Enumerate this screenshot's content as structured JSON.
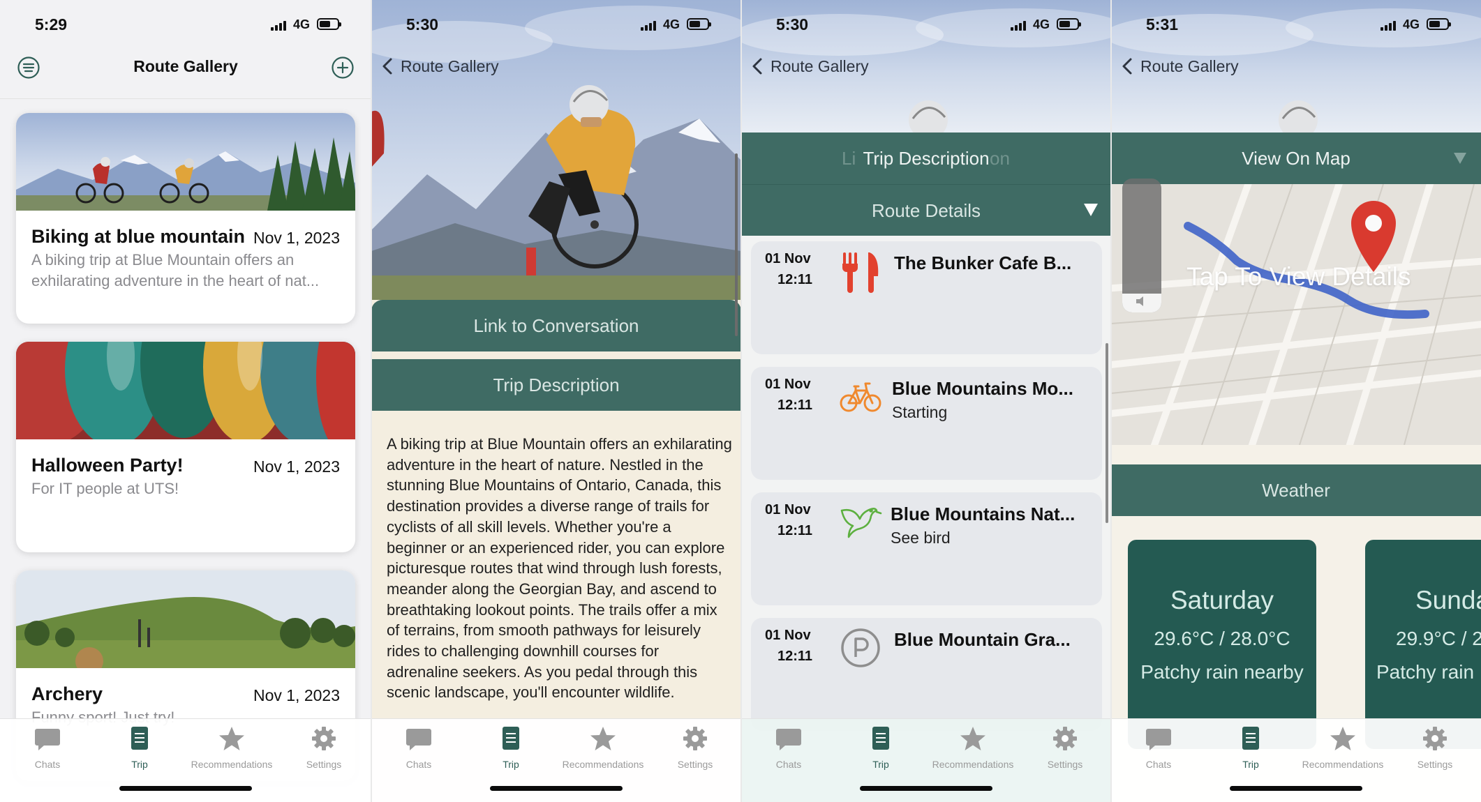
{
  "status_bars": [
    {
      "time": "5:29",
      "network": "4G"
    },
    {
      "time": "5:30",
      "network": "4G"
    },
    {
      "time": "5:30",
      "network": "4G"
    },
    {
      "time": "5:31",
      "network": "4G"
    }
  ],
  "gallery": {
    "title": "Route Gallery",
    "cards": [
      {
        "title": "Biking at blue mountain",
        "date": "Nov 1, 2023",
        "description": "A biking trip at Blue Mountain offers an exhilarating adventure in the heart of nat..."
      },
      {
        "title": "Halloween Party!",
        "date": "Nov 1, 2023",
        "description": "For IT people at UTS!"
      },
      {
        "title": "Archery",
        "date": "Nov 1, 2023",
        "description": "Funny sport! Just try!"
      }
    ]
  },
  "back_label": "Route Gallery",
  "detail": {
    "link_button": "Link to Conversation",
    "trip_description_header": "Trip Description",
    "description": "A biking trip at Blue Mountain offers an exhilarating adventure in the heart of nature. Nestled in the stunning Blue Mountains of Ontario, Canada, this destination provides a diverse range of trails for cyclists of all skill levels. Whether you're a beginner or an experienced rider, you can explore picturesque routes that wind through lush forests, meander along the Georgian Bay, and ascend to breathtaking lookout points. The trails offer a mix of terrains, from smooth pathways for leisurely rides to challenging downhill courses for adrenaline seekers. As you pedal through this scenic landscape, you'll encounter wildlife."
  },
  "route": {
    "trip_description_header": "Trip Description",
    "ghost_left": "Li",
    "ghost_right": "on",
    "route_details_header": "Route Details",
    "stops": [
      {
        "day": "01 Nov",
        "time": "12:11",
        "icon": "fork-knife-icon",
        "name": "The Bunker Cafe B...",
        "note": ""
      },
      {
        "day": "01 Nov",
        "time": "12:11",
        "icon": "bicycle-icon",
        "name": "Blue Mountains Mo...",
        "note": "Starting"
      },
      {
        "day": "01 Nov",
        "time": "12:11",
        "icon": "bird-icon",
        "name": "Blue Mountains Nat...",
        "note": "See bird"
      },
      {
        "day": "01 Nov",
        "time": "12:11",
        "icon": "parking-icon",
        "name": "Blue Mountain Gra...",
        "note": ""
      }
    ]
  },
  "map_panel": {
    "view_on_map": "View On Map",
    "tap_to_view": "Tap To View Details",
    "volume_level": 0.14,
    "weather_header": "Weather",
    "weather_cards": [
      {
        "day": "Saturday",
        "temps": "29.6°C / 28.0°C",
        "condition": "Patchy rain nearby"
      },
      {
        "day": "Sunda",
        "temps": "29.9°C / 2",
        "condition": "Patchy rain"
      }
    ]
  },
  "tabs": [
    {
      "label": "Chats",
      "icon": "chat-bubble-icon"
    },
    {
      "label": "Trip",
      "icon": "trip-book-icon"
    },
    {
      "label": "Recommendations",
      "icon": "star-icon"
    },
    {
      "label": "Settings",
      "icon": "gear-icon"
    }
  ],
  "colors": {
    "teal_bar": "#3f6b64",
    "weather_card": "#245a52",
    "accent_orange": "#f0892e",
    "accent_red": "#e2412e",
    "accent_green": "#5db040"
  }
}
